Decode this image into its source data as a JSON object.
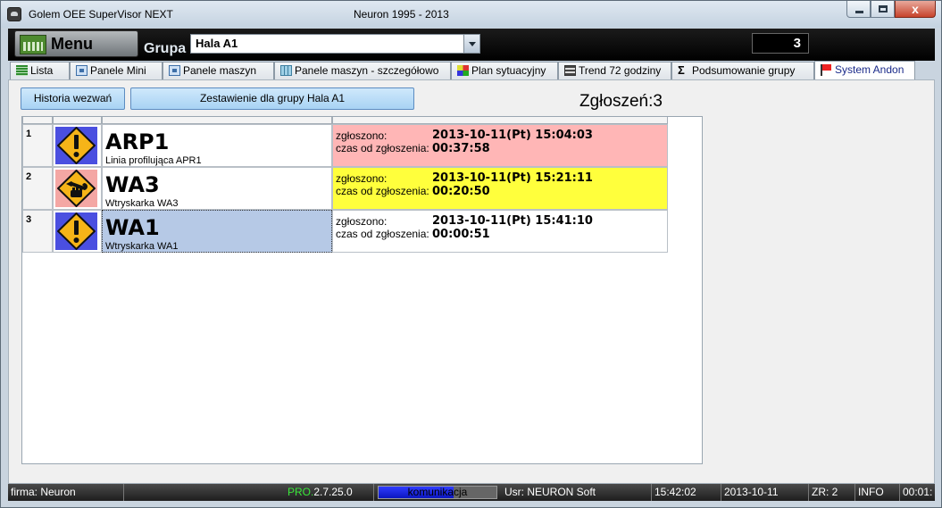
{
  "window": {
    "title": "Golem OEE SuperVisor NEXT",
    "center_title": "Neuron 1995 - 2013",
    "close_glyph": "x"
  },
  "toolbar": {
    "menu_label": "Menu",
    "group_label": "Grupa",
    "group_value": "Hala A1",
    "counter": "3"
  },
  "tabs": [
    {
      "label": "Lista",
      "icon": "list-icon"
    },
    {
      "label": "Panele Mini",
      "icon": "panel-icon"
    },
    {
      "label": "Panele maszyn",
      "icon": "panel-icon"
    },
    {
      "label": "Panele maszyn - szczegółowo",
      "icon": "panel-detail-icon"
    },
    {
      "label": "Plan sytuacyjny",
      "icon": "plan-icon"
    },
    {
      "label": "Trend 72 godziny",
      "icon": "trend-icon"
    },
    {
      "label": "Podsumowanie grupy",
      "icon": "sigma-icon"
    },
    {
      "label": "System Andon",
      "icon": "flag-icon",
      "active": true
    }
  ],
  "content": {
    "history_button": "Historia wezwań",
    "summary_button": "Zestawienie dla grupy Hala A1",
    "reports_count": "Zgłoszeń:3"
  },
  "calls": [
    {
      "num": "1",
      "name": "ARP1",
      "desc": "Linia profilująca APR1",
      "label_reported": "zgłoszono:",
      "label_elapsed": "czas od zgłoszenia:",
      "reported": "2013-10-11(Pt) 15:04:03",
      "elapsed": "00:37:58",
      "icon": "warning-icon",
      "time_color": "#ffb6b6"
    },
    {
      "num": "2",
      "name": "WA3",
      "desc": "Wtryskarka WA3",
      "label_reported": "zgłoszono:",
      "label_elapsed": "czas od zgłoszenia:",
      "reported": "2013-10-11(Pt) 15:21:11",
      "elapsed": "00:20:50",
      "icon": "maintenance-icon",
      "time_color": "#ffff3c"
    },
    {
      "num": "3",
      "name": "WA1",
      "desc": "Wtryskarka WA1",
      "label_reported": "zgłoszono:",
      "label_elapsed": "czas od zgłoszenia:",
      "reported": "2013-10-11(Pt) 15:41:10",
      "elapsed": "00:00:51",
      "icon": "warning-icon",
      "time_color": "#ffffff",
      "selected": true
    }
  ],
  "colors": {
    "selected_row": "#b6c9e6",
    "icon_blue": "#4a4fe0",
    "icon_pink": "#f4a7a4"
  },
  "status": {
    "company": "firma: Neuron",
    "version_prefix": "PRO.",
    "version": "2.7.25.0",
    "comm_label": "komunikacja",
    "comm_progress": 0.64,
    "user": "Usr: NEURON Soft",
    "time": "15:42:02",
    "date": "2013-10-11",
    "zr": "ZR: 2",
    "info": "INFO",
    "clock": "00:01:"
  }
}
